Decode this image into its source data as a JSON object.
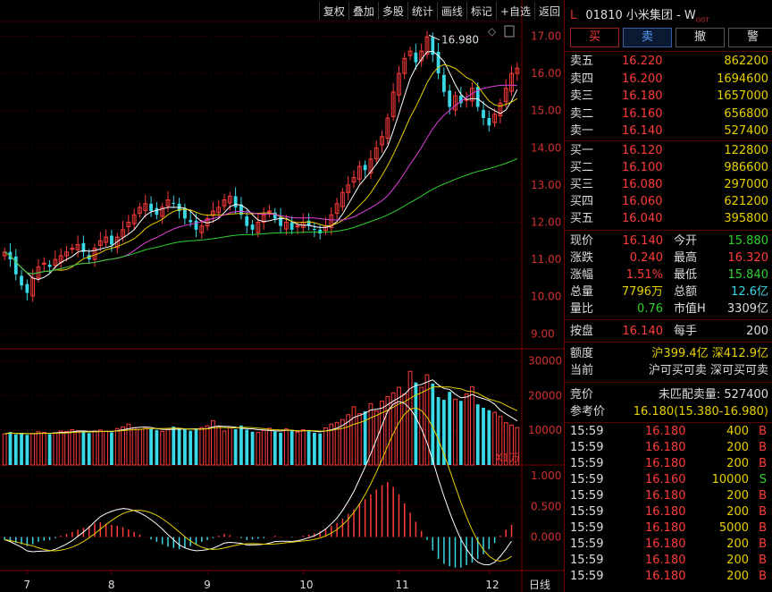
{
  "toolbar": [
    "复权",
    "叠加",
    "多股",
    "统计",
    "画线",
    "标记",
    "+自选",
    "返回"
  ],
  "stock": {
    "prefix": "L",
    "code": "01810",
    "name": "小米集团 - W",
    "tag": "GGT"
  },
  "actions": {
    "buy": "买",
    "sell": "卖",
    "cancel": "撤",
    "alert": "警"
  },
  "asks": [
    {
      "label": "卖五",
      "price": "16.220",
      "vol": "862200"
    },
    {
      "label": "卖四",
      "price": "16.200",
      "vol": "1694600"
    },
    {
      "label": "卖三",
      "price": "16.180",
      "vol": "1657000"
    },
    {
      "label": "卖二",
      "price": "16.160",
      "vol": "656800"
    },
    {
      "label": "卖一",
      "price": "16.140",
      "vol": "527400"
    }
  ],
  "bids": [
    {
      "label": "买一",
      "price": "16.120",
      "vol": "122800"
    },
    {
      "label": "买二",
      "price": "16.100",
      "vol": "986600"
    },
    {
      "label": "买三",
      "price": "16.080",
      "vol": "297000"
    },
    {
      "label": "买四",
      "price": "16.060",
      "vol": "621200"
    },
    {
      "label": "买五",
      "price": "16.040",
      "vol": "395800"
    }
  ],
  "stats": [
    {
      "l": "现价",
      "v": "16.140",
      "l2": "今开",
      "v2": "15.880"
    },
    {
      "l": "涨跌",
      "v": "0.240",
      "l2": "最高",
      "v2": "16.320"
    },
    {
      "l": "涨幅",
      "v": "1.51%",
      "l2": "最低",
      "v2": "15.840"
    },
    {
      "l": "总量",
      "v": "7796万",
      "l2": "总额",
      "v2": "12.6亿"
    },
    {
      "l": "量比",
      "v": "0.76",
      "l2": "市值H",
      "v2": "3309亿"
    }
  ],
  "close": {
    "l": "按盘",
    "v": "16.140",
    "l2": "每手",
    "v2": "200"
  },
  "quota": {
    "l": "额度",
    "v": "沪399.4亿 深412.9亿"
  },
  "current": {
    "l": "当前",
    "v": "沪可买可卖 深可买可卖"
  },
  "auction": {
    "l": "竞价",
    "v": "未匹配卖量: 527400"
  },
  "ref": {
    "l": "参考价",
    "v": "16.180(15.380-16.980)"
  },
  "ticks": [
    {
      "t": "15:59",
      "p": "16.180",
      "v": "400",
      "s": "B"
    },
    {
      "t": "15:59",
      "p": "16.180",
      "v": "200",
      "s": "B"
    },
    {
      "t": "15:59",
      "p": "16.180",
      "v": "200",
      "s": "B"
    },
    {
      "t": "15:59",
      "p": "16.160",
      "v": "10000",
      "s": "S"
    },
    {
      "t": "15:59",
      "p": "16.180",
      "v": "200",
      "s": "B"
    },
    {
      "t": "15:59",
      "p": "16.180",
      "v": "200",
      "s": "B"
    },
    {
      "t": "15:59",
      "p": "16.180",
      "v": "5000",
      "s": "B"
    },
    {
      "t": "15:59",
      "p": "16.180",
      "v": "200",
      "s": "B"
    },
    {
      "t": "15:59",
      "p": "16.180",
      "v": "200",
      "s": "B"
    },
    {
      "t": "15:59",
      "p": "16.180",
      "v": "200",
      "s": "B"
    }
  ],
  "chart_data": {
    "type": "candlestick",
    "price_ticks": [
      "17.00",
      "16.00",
      "15.00",
      "14.00",
      "13.00",
      "12.00",
      "11.00",
      "10.00",
      "9.00"
    ],
    "high_label": "16.980",
    "volume_ticks": [
      "30000",
      "20000",
      "10000"
    ],
    "volume_unit": "X1万",
    "macd_ticks": [
      "1.000",
      "0.500",
      "0.000"
    ],
    "x_labels": [
      "7",
      "8",
      "9",
      "10",
      "11",
      "12"
    ],
    "period": "日线",
    "price_range": [
      8.6,
      17.3
    ],
    "closes": [
      11.2,
      11.0,
      10.6,
      10.3,
      10.1,
      10.5,
      10.8,
      10.9,
      10.8,
      11.0,
      11.1,
      11.2,
      11.3,
      11.4,
      11.2,
      11.0,
      11.3,
      11.5,
      11.6,
      11.4,
      11.6,
      11.8,
      12.0,
      12.2,
      12.4,
      12.5,
      12.3,
      12.2,
      12.4,
      12.6,
      12.5,
      12.3,
      12.1,
      12.0,
      11.8,
      11.9,
      12.1,
      12.3,
      12.4,
      12.6,
      12.7,
      12.4,
      12.2,
      11.9,
      11.8,
      12.0,
      12.2,
      12.3,
      12.1,
      11.9,
      12.0,
      11.8,
      11.9,
      12.0,
      11.9,
      11.8,
      11.7,
      11.9,
      12.2,
      12.5,
      12.8,
      13.0,
      13.2,
      13.5,
      13.4,
      13.7,
      14.0,
      14.3,
      14.8,
      15.5,
      16.0,
      16.4,
      16.6,
      16.3,
      16.6,
      16.98,
      16.5,
      16.0,
      15.5,
      15.1,
      15.4,
      15.2,
      15.3,
      15.6,
      15.1,
      14.8,
      14.6,
      14.9,
      15.2,
      15.6,
      16.0,
      16.14
    ],
    "volumes": [
      9000,
      9500,
      8800,
      9200,
      8700,
      9100,
      9600,
      9400,
      8900,
      9300,
      9800,
      9700,
      10200,
      9900,
      9500,
      9200,
      9800,
      10100,
      9700,
      9400,
      10500,
      11000,
      11800,
      10800,
      10300,
      10900,
      10400,
      10100,
      9700,
      10200,
      11100,
      10600,
      10200,
      9900,
      10400,
      10800,
      11300,
      12800,
      10900,
      9800,
      10700,
      10300,
      11400,
      10200,
      9600,
      9400,
      10000,
      10600,
      9700,
      9300,
      10400,
      9900,
      9500,
      10200,
      9800,
      9300,
      9100,
      10700,
      11800,
      12300,
      13100,
      14500,
      16800,
      14800,
      15500,
      17700,
      15600,
      18400,
      19700,
      20800,
      22400,
      20500,
      27000,
      23800,
      22400,
      26000,
      23500,
      19600,
      18800,
      21100,
      19000,
      18500,
      20500,
      22600,
      17500,
      16500,
      15800,
      15200,
      14000,
      12200,
      11500,
      10800
    ],
    "macd_hist": [
      -0.05,
      -0.07,
      -0.1,
      -0.12,
      -0.15,
      -0.12,
      -0.08,
      -0.06,
      -0.05,
      -0.02,
      0.02,
      0.05,
      0.08,
      0.12,
      0.15,
      0.18,
      0.22,
      0.24,
      0.22,
      0.2,
      0.18,
      0.16,
      0.12,
      0.08,
      0.04,
      0.0,
      -0.04,
      -0.08,
      -0.12,
      -0.16,
      -0.18,
      -0.2,
      -0.18,
      -0.15,
      -0.12,
      -0.08,
      -0.05,
      -0.02,
      0.02,
      0.05,
      0.03,
      0.0,
      -0.02,
      -0.05,
      -0.04,
      -0.03,
      -0.02,
      0.0,
      0.02,
      0.01,
      0.0,
      -0.01,
      0.0,
      0.02,
      0.04,
      0.06,
      0.09,
      0.13,
      0.18,
      0.23,
      0.3,
      0.38,
      0.45,
      0.55,
      0.62,
      0.7,
      0.78,
      0.85,
      0.9,
      0.82,
      0.7,
      0.55,
      0.4,
      0.25,
      0.1,
      -0.05,
      -0.22,
      -0.36,
      -0.44,
      -0.48,
      -0.5,
      -0.5,
      -0.46,
      -0.42,
      -0.36,
      -0.28,
      -0.2,
      -0.1,
      0.02,
      0.12,
      0.2
    ],
    "macd_range": [
      -0.55,
      1.15
    ]
  }
}
